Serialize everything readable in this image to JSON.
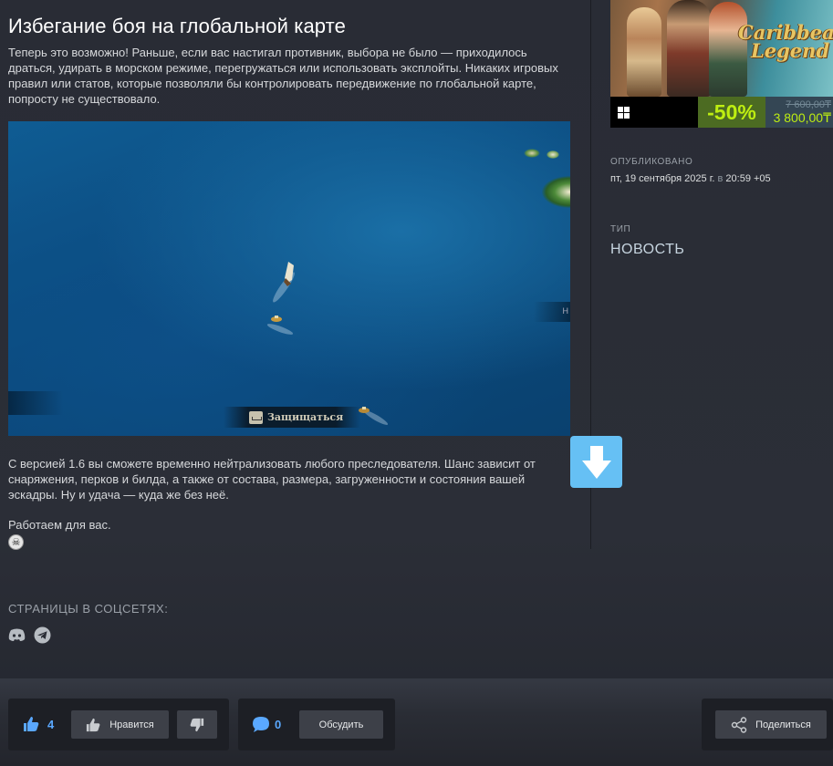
{
  "article": {
    "title": "Избегание боя на глобальной карте",
    "intro": "Теперь это возможно! Раньше, если вас настигал противник, выбора не было — приходилось драться, удирать в морском режиме, перегружаться или использовать эксплойты. Никаких игровых правил или статов, которые позволяли бы контролировать передвижение по глобальной карте, попросту не существовало.",
    "image": {
      "hud_button_label": "Защищаться",
      "hud_right_letter": "Н"
    },
    "body": "С версией 1.6 вы сможете временно нейтрализовать любого преследователя. Шанс зависит от снаряжения, перков и билда, а также от состава, размера, загруженности и состояния вашей эскадры. Ну и удача — куда же без неё.",
    "sign": "Работаем для вас.",
    "emoji_icon": "skull-icon"
  },
  "download_button": {
    "icon": "arrow-down-icon",
    "color": "#66c0f4"
  },
  "sidebar": {
    "game": {
      "logo_text_line1": "Caribbean",
      "logo_text_line2": "Legend",
      "platform_icon": "windows-icon",
      "discount": "-50%",
      "original_price": "7 600,00₸",
      "final_price": "3 800,00₸",
      "discount_bg": "#4c6b22",
      "discount_color": "#beee11"
    },
    "published_label": "ОПУБЛИКОВАНО",
    "published_date": "пт, 19 сентября 2025 г.",
    "published_at_word": "в",
    "published_time": "20:59 +05",
    "type_label": "ТИП",
    "type_value": "НОВОСТЬ"
  },
  "social": {
    "label": "СТРАНИЦЫ В СОЦСЕТЯХ:",
    "icons": [
      "discord-icon",
      "telegram-icon"
    ]
  },
  "footer": {
    "like_count": "4",
    "like_label": "Нравится",
    "comment_count": "0",
    "discuss_label": "Обсудить",
    "share_label": "Поделиться",
    "accent": "#5aa8ff"
  }
}
